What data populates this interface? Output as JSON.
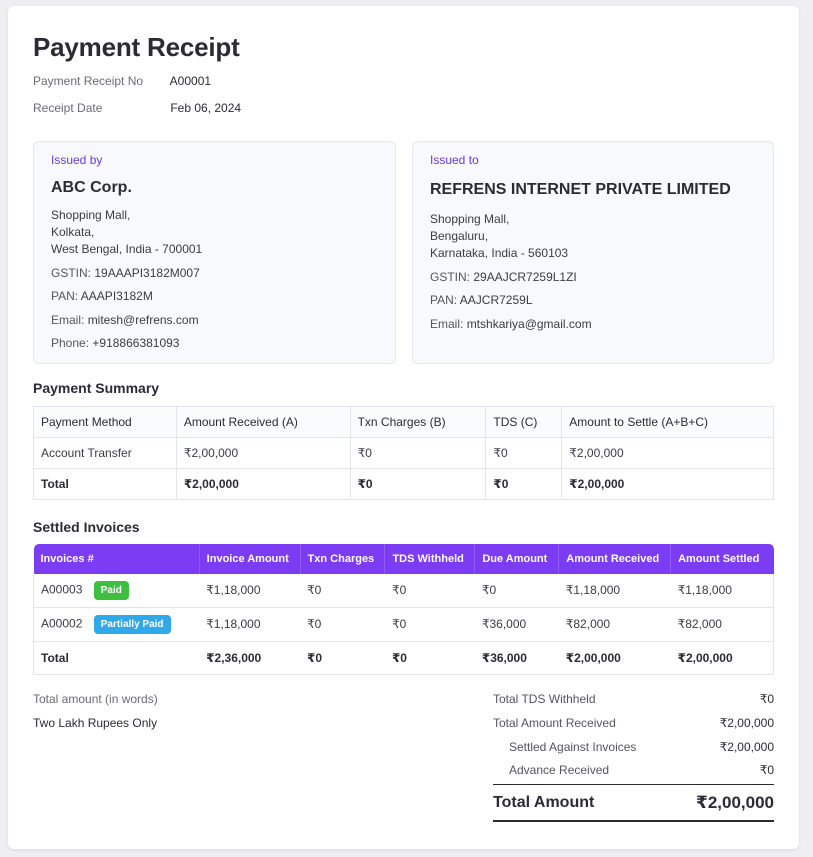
{
  "receipt": {
    "title": "Payment Receipt",
    "number_label": "Payment Receipt No",
    "number_value": "A00001",
    "date_label": "Receipt Date",
    "date_value": "Feb 06, 2024"
  },
  "issued_by": {
    "tag": "Issued by",
    "name": "ABC Corp.",
    "address": [
      "Shopping Mall,",
      "Kolkata,",
      "West Bengal, India - 700001"
    ],
    "gstin_label": "GSTIN:",
    "gstin": "19AAAPI3182M007",
    "pan_label": "PAN:",
    "pan": "AAAPI3182M",
    "email_label": "Email:",
    "email": "mitesh@refrens.com",
    "phone_label": "Phone:",
    "phone": "+918866381093"
  },
  "issued_to": {
    "tag": "Issued to",
    "name": "REFRENS INTERNET PRIVATE LIMITED",
    "address": [
      "Shopping Mall,",
      "Bengaluru,",
      "Karnataka, India - 560103"
    ],
    "gstin_label": "GSTIN:",
    "gstin": "29AAJCR7259L1ZI",
    "pan_label": "PAN:",
    "pan": "AAJCR7259L",
    "email_label": "Email:",
    "email": "mtshkariya@gmail.com"
  },
  "payment_summary": {
    "title": "Payment Summary",
    "headers": [
      "Payment Method",
      "Amount Received (A)",
      "Txn Charges (B)",
      "TDS (C)",
      "Amount to Settle (A+B+C)"
    ],
    "rows": [
      [
        "Account Transfer",
        "₹2,00,000",
        "₹0",
        "₹0",
        "₹2,00,000"
      ]
    ],
    "total": [
      "Total",
      "₹2,00,000",
      "₹0",
      "₹0",
      "₹2,00,000"
    ]
  },
  "settled_invoices": {
    "title": "Settled Invoices",
    "headers": [
      "Invoices #",
      "Invoice Amount",
      "Txn Charges",
      "TDS Withheld",
      "Due Amount",
      "Amount Received",
      "Amount Settled"
    ],
    "rows": [
      {
        "invoice": "A00003",
        "status": "Paid",
        "cells": [
          "₹1,18,000",
          "₹0",
          "₹0",
          "₹0",
          "₹1,18,000",
          "₹1,18,000"
        ]
      },
      {
        "invoice": "A00002",
        "status": "Partially Paid",
        "cells": [
          "₹1,18,000",
          "₹0",
          "₹0",
          "₹36,000",
          "₹82,000",
          "₹82,000"
        ]
      }
    ],
    "total": [
      "Total",
      "₹2,36,000",
      "₹0",
      "₹0",
      "₹36,000",
      "₹2,00,000",
      "₹2,00,000"
    ]
  },
  "amount_words": {
    "label": "Total amount (in words)",
    "value": "Two Lakh Rupees Only"
  },
  "totals": {
    "tds_label": "Total TDS Withheld",
    "tds": "₹0",
    "received_label": "Total Amount Received",
    "received": "₹2,00,000",
    "settled_label": "Settled Against Invoices",
    "settled": "₹2,00,000",
    "advance_label": "Advance Received",
    "advance": "₹0",
    "grand_label": "Total Amount",
    "grand": "₹2,00,000"
  },
  "colors": {
    "accent": "#7b3cf3",
    "paid_badge": "#3fbf3f",
    "partial_badge": "#2fa9e9"
  }
}
